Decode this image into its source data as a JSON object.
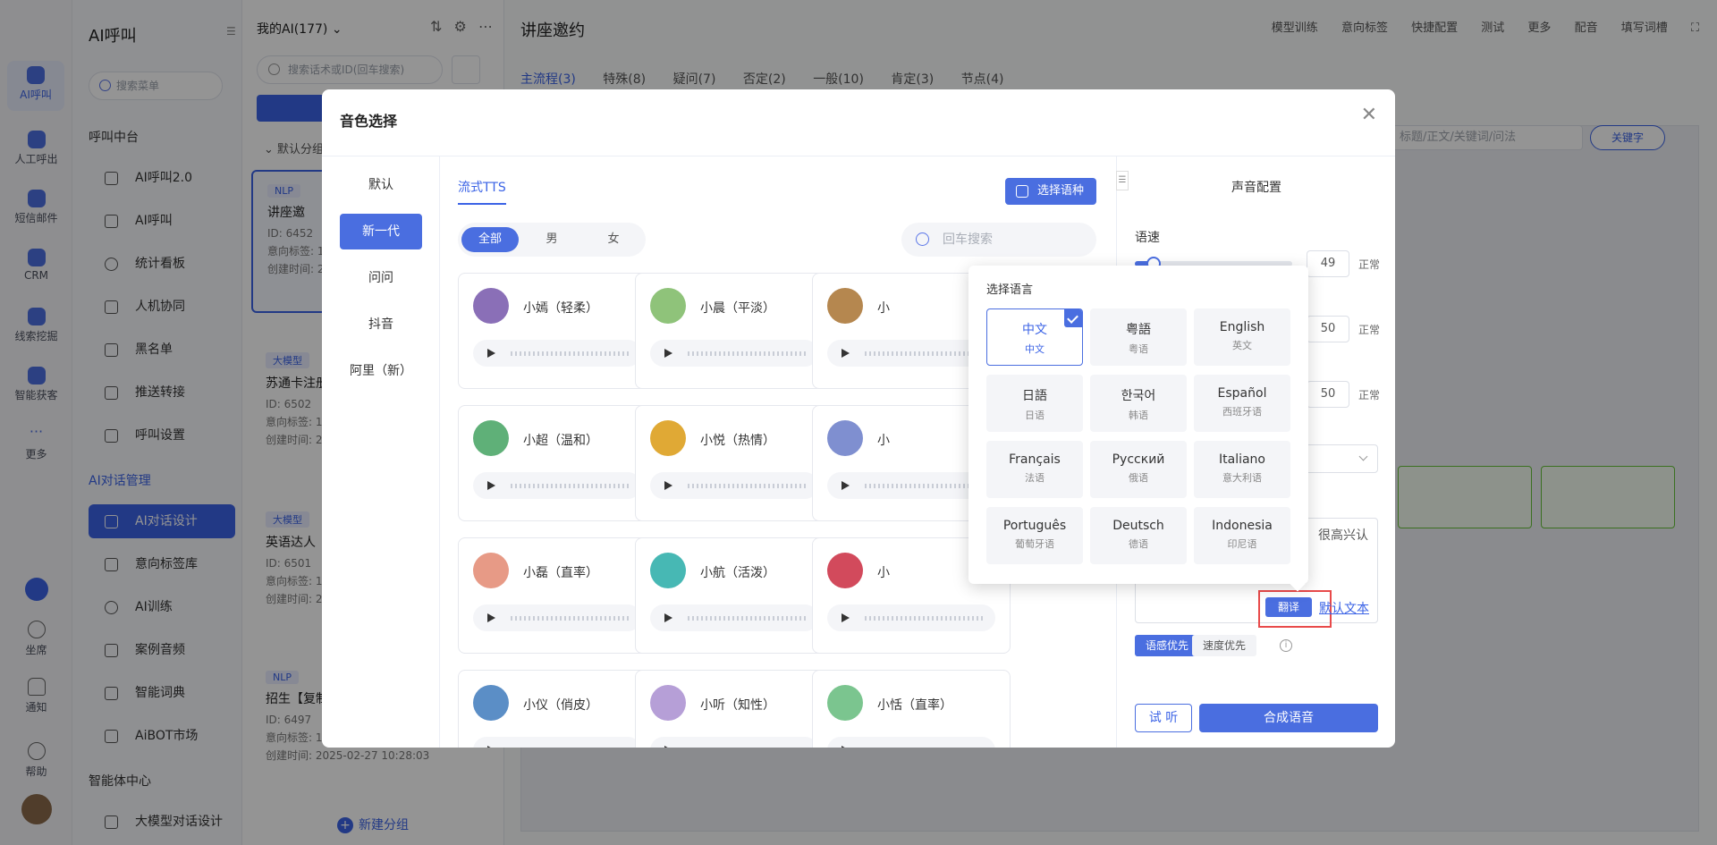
{
  "rail": {
    "items": [
      {
        "label": "AI呼叫",
        "active": true
      },
      {
        "label": "人工呼出"
      },
      {
        "label": "短信邮件"
      },
      {
        "label": "CRM"
      },
      {
        "label": "线索挖掘"
      },
      {
        "label": "智能获客"
      },
      {
        "label": "更多"
      }
    ],
    "bottom": [
      {
        "label": "坐席"
      },
      {
        "label": "通知"
      },
      {
        "label": "帮助"
      }
    ]
  },
  "menu": {
    "title": "AI呼叫",
    "search_placeholder": "搜索菜单",
    "group1": "呼叫中台",
    "items1": [
      "AI呼叫2.0",
      "AI呼叫",
      "统计看板",
      "人机协同",
      "黑名单",
      "推送转接",
      "呼叫设置"
    ],
    "group2": "AI对话管理",
    "items2": [
      "AI对话设计",
      "意向标签库",
      "AI训练",
      "案例音频",
      "智能词典",
      "AiBOT市场"
    ],
    "group3": "智能体中心",
    "items3": [
      "大模型对话设计"
    ]
  },
  "list": {
    "header": "我的AI(177)",
    "search_placeholder": "搜索话术或ID(回车搜索)",
    "group_label": "默认分组",
    "cards": [
      {
        "tag": "NLP",
        "name": "讲座邀",
        "id": "ID: 6452",
        "intent": "意向标签: 1",
        "created": "创建时间: 2"
      },
      {
        "tag": "大模型",
        "name": "苏通卡注册",
        "id": "ID: 6502",
        "intent": "意向标签: 1",
        "created": "创建时间: 2"
      },
      {
        "tag": "大模型",
        "name": "英语达人",
        "id": "ID: 6501",
        "intent": "意向标签: 1",
        "created": "创建时间: 2"
      },
      {
        "tag": "NLP",
        "name": "招生【复制",
        "id": "ID: 6497",
        "intent": "意向标签: 1",
        "created": "创建时间: 2025-02-27 10:28:03"
      }
    ],
    "new_group": "新建分组"
  },
  "main": {
    "title": "讲座邀约",
    "tools": [
      "模型训练",
      "意向标签",
      "快捷配置",
      "测试",
      "更多",
      "配音",
      "填写词槽"
    ],
    "tabs": [
      "主流程(3)",
      "特殊(8)",
      "疑问(7)",
      "否定(2)",
      "一般(10)",
      "肯定(3)",
      "节点(4)"
    ],
    "search_placeholder": "标题/正文/关键词/问法",
    "keyword_btn": "关键字"
  },
  "modal": {
    "title": "音色选择",
    "vendors": [
      "默认",
      "新一代",
      "问问",
      "抖音",
      "阿里（新）"
    ],
    "active_vendor": 1,
    "tts_tab": "流式TTS",
    "lang_button": "选择语种",
    "gender_tabs": [
      "全部",
      "男",
      "女"
    ],
    "voice_search_placeholder": "回车搜索",
    "voices": [
      {
        "name": "小嫣（轻柔）",
        "color": "#8a6fb7"
      },
      {
        "name": "小晨（平淡）",
        "color": "#8fc37a"
      },
      {
        "name": "小",
        "color": "#b5874f"
      },
      {
        "name": "小超（温和）",
        "color": "#5fb078"
      },
      {
        "name": "小悦（热情）",
        "color": "#e0a935"
      },
      {
        "name": "小",
        "color": "#7f8fd0"
      },
      {
        "name": "小磊（直率）",
        "color": "#e79a86"
      },
      {
        "name": "小航（活泼）",
        "color": "#47b8b4"
      },
      {
        "name": "小",
        "color": "#d24a5c"
      },
      {
        "name": "小仪（俏皮）",
        "color": "#5b8ec6"
      },
      {
        "name": "小听（知性）",
        "color": "#b69fd7"
      },
      {
        "name": "小恬（直率）",
        "color": "#7bc58f"
      }
    ],
    "voice_config": {
      "title": "声音配置",
      "speed_label": "语速",
      "speed_value": "49",
      "speed_fraction": 0.04,
      "vol_value": "50",
      "pitch_value": "50",
      "normal": "正常",
      "text_snippet": "很高兴认",
      "translate": "翻译",
      "default_text": "默认文本",
      "priority_on": "语感优先",
      "priority_off": "速度优先",
      "info": "i",
      "listen": "试 听",
      "synthesize": "合成语音"
    }
  },
  "lang_popup": {
    "title": "选择语言",
    "languages": [
      {
        "name": "中文",
        "sub": "中文",
        "selected": true
      },
      {
        "name": "粤語",
        "sub": "粤语"
      },
      {
        "name": "English",
        "sub": "英文"
      },
      {
        "name": "日語",
        "sub": "日语"
      },
      {
        "name": "한국어",
        "sub": "韩语"
      },
      {
        "name": "Español",
        "sub": "西班牙语"
      },
      {
        "name": "Français",
        "sub": "法语"
      },
      {
        "name": "Русский",
        "sub": "俄语"
      },
      {
        "name": "Italiano",
        "sub": "意大利语"
      },
      {
        "name": "Português",
        "sub": "葡萄牙语"
      },
      {
        "name": "Deutsch",
        "sub": "德语"
      },
      {
        "name": "Indonesia",
        "sub": "印尼语"
      }
    ]
  },
  "colors": {
    "accent": "#4a6ee0",
    "highlight_box": "#e84a4a"
  }
}
